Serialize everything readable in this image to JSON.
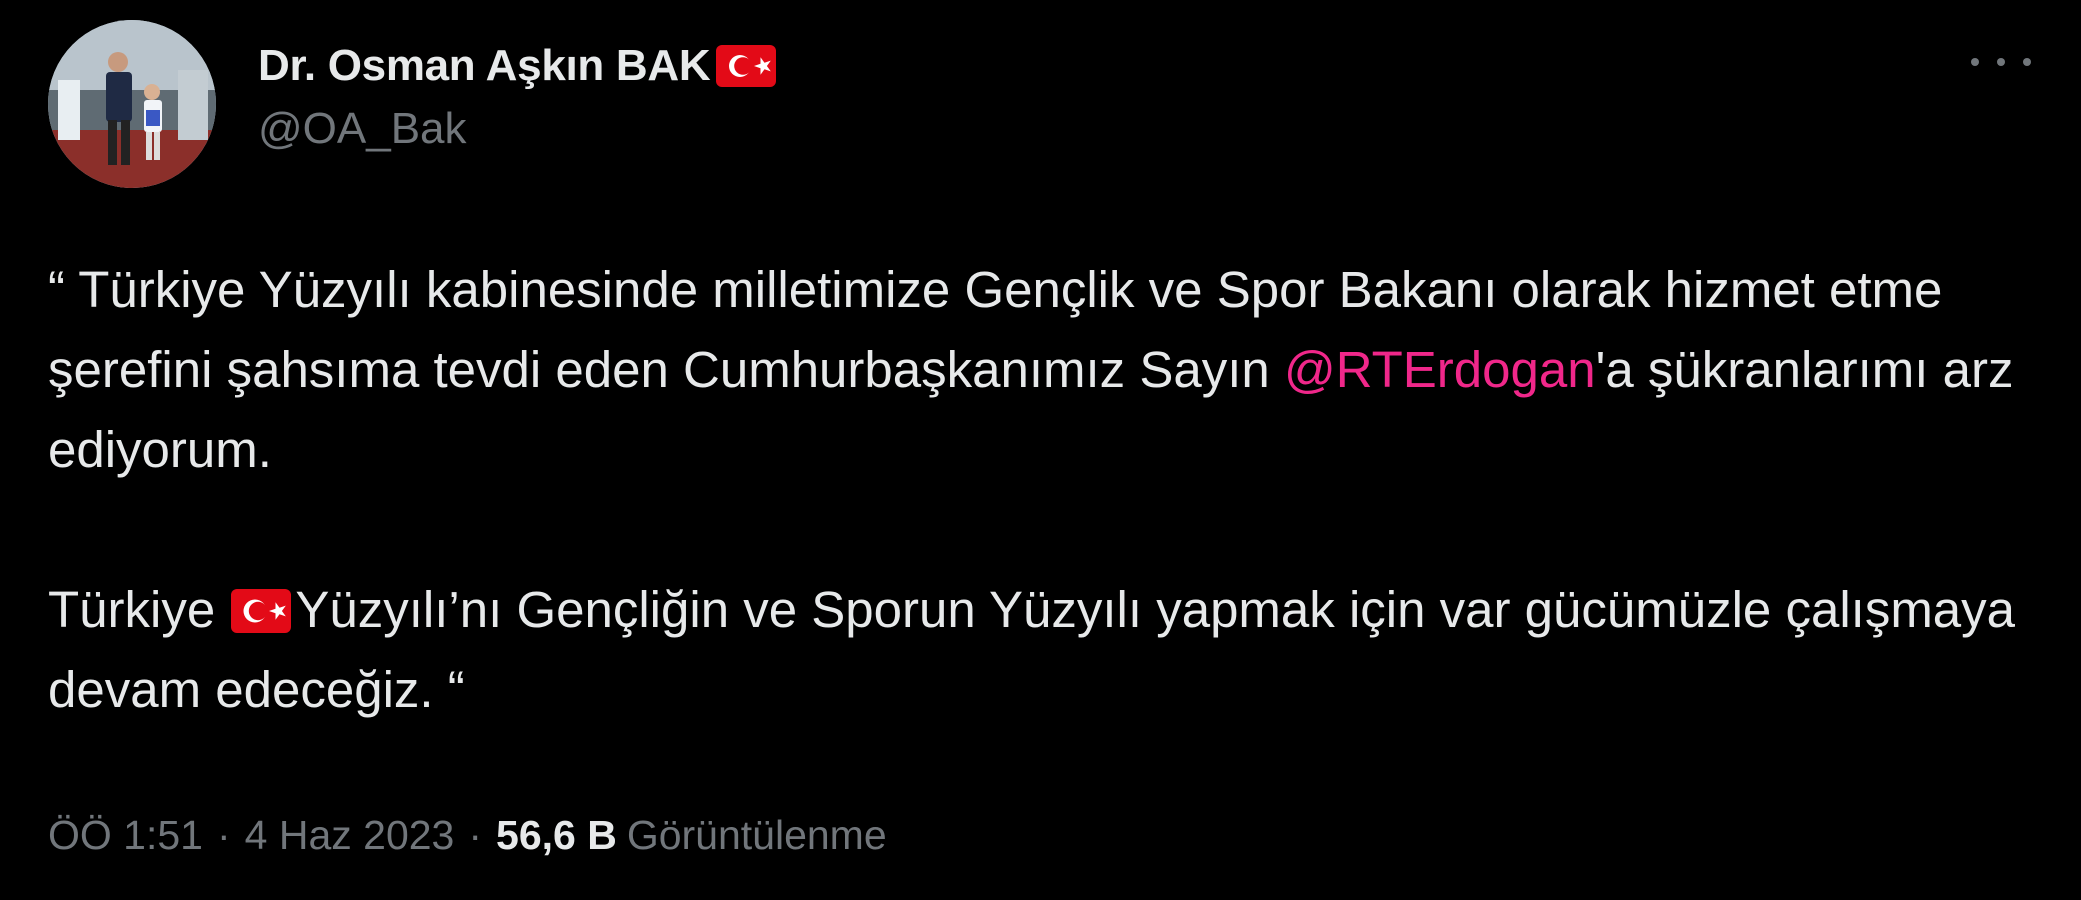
{
  "author": {
    "display_name": "Dr. Osman Aşkın BAK",
    "handle": "@OA_Bak",
    "avatar_icon": "profile-photo-icon",
    "name_flag_icon": "turkey-flag-icon"
  },
  "menu": {
    "icon": "more-options-icon"
  },
  "tweet": {
    "p1_text": "“ Türkiye Yüzyılı kabinesinde milletimize Gençlik ve Spor Bakanı olarak hizmet etme şerefini şahsıma tevdi eden Cumhurbaşkanımız Sayın ",
    "mention": "@RTErdogan",
    "p1_after": "'a şükranlarımı arz ediyorum.",
    "p2_before": "Türkiye ",
    "p2_flag_icon": "turkey-flag-icon",
    "p2_after": "Yüzyılı’nı Gençliğin ve Sporun Yüzyılı yapmak için var gücümüzle çalışmaya devam edeceğiz. “"
  },
  "meta": {
    "time": "ÖÖ 1:51",
    "separator": "·",
    "date": "4 Haz 2023",
    "views_count": "56,6 B",
    "views_label": "Görüntülenme"
  },
  "colors": {
    "background": "#000000",
    "primary_text": "#e7e9ea",
    "secondary_text": "#71767b",
    "mention": "#f0278a",
    "flag_red": "#e30a17"
  }
}
